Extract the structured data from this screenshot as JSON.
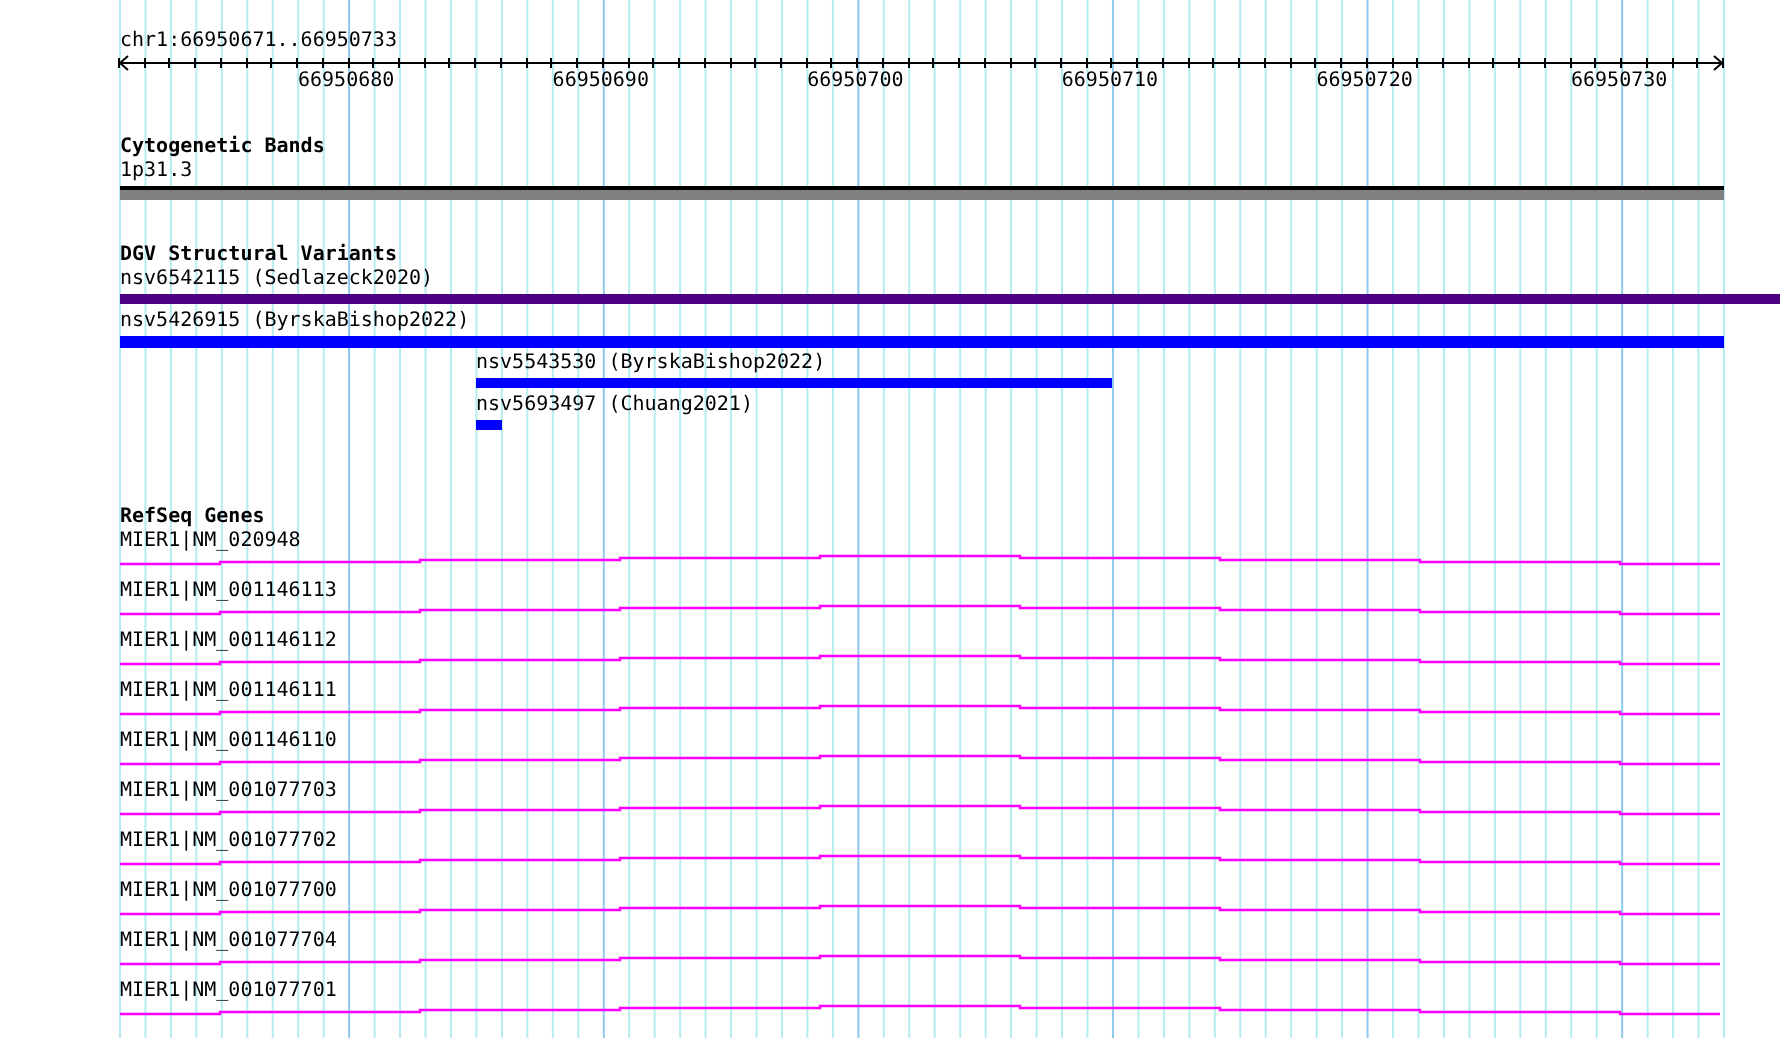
{
  "location": "chr1:66950671..66950733",
  "ruler": {
    "tick_labels": [
      "66950680",
      "66950690",
      "66950700",
      "66950710",
      "66950720",
      "66950730"
    ]
  },
  "tracks": [
    {
      "kind": "cytoband",
      "title": "Cytogenetic Bands",
      "features": [
        {
          "label": "1p31.3"
        }
      ]
    },
    {
      "kind": "variant",
      "title": "DGV Structural Variants",
      "features": [
        {
          "label": "nsv6542115 (Sedlazeck2020)",
          "color": "#4b0082"
        },
        {
          "label": "nsv5426915 (ByrskaBishop2022)",
          "color": "#0000ff"
        },
        {
          "label": "nsv5543530 (ByrskaBishop2022)",
          "color": "#0000ff"
        },
        {
          "label": "nsv5693497 (Chuang2021)",
          "color": "#0000ff"
        }
      ]
    },
    {
      "kind": "gene",
      "title": "RefSeq Genes",
      "features": [
        {
          "label": "MIER1|NM_020948"
        },
        {
          "label": "MIER1|NM_001146113"
        },
        {
          "label": "MIER1|NM_001146112"
        },
        {
          "label": "MIER1|NM_001146111"
        },
        {
          "label": "MIER1|NM_001146110"
        },
        {
          "label": "MIER1|NM_001077703"
        },
        {
          "label": "MIER1|NM_001077702"
        },
        {
          "label": "MIER1|NM_001077700"
        },
        {
          "label": "MIER1|NM_001077704"
        },
        {
          "label": "MIER1|NM_001077701"
        }
      ]
    }
  ]
}
